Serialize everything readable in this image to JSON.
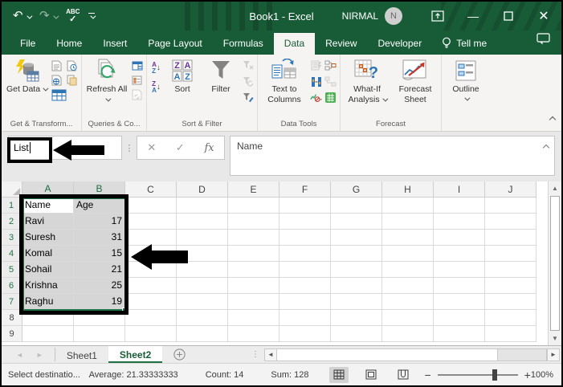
{
  "window": {
    "title": "Book1  -  Excel",
    "user": "NIRMAL",
    "avatar_initial": "N"
  },
  "menu": {
    "tabs": [
      "File",
      "Home",
      "Insert",
      "Page Layout",
      "Formulas",
      "Data",
      "Review",
      "Developer"
    ],
    "active_tab": "Data",
    "tell_me": "Tell me"
  },
  "ribbon": {
    "buttons": {
      "get_data": "Get Data",
      "refresh_all": "Refresh All",
      "sort": "Sort",
      "filter": "Filter",
      "text_to_columns": "Text to Columns",
      "what_if_analysis": "What-If Analysis",
      "forecast_sheet": "Forecast Sheet",
      "outline": "Outline"
    },
    "group_labels": {
      "get_transform": "Get & Transform...",
      "queries": "Queries & Co...",
      "sort_filter": "Sort & Filter",
      "data_tools": "Data Tools",
      "forecast": "Forecast"
    }
  },
  "formula": {
    "name_box_value": "List",
    "formula_bar_value": "Name"
  },
  "grid": {
    "columns": [
      "A",
      "B",
      "C",
      "D",
      "E",
      "F",
      "G",
      "H",
      "I",
      "J"
    ],
    "row_numbers": [
      1,
      2,
      3,
      4,
      5,
      6,
      7,
      8,
      9
    ],
    "cells": [
      [
        "Name",
        "Age"
      ],
      [
        "Ravi",
        "17"
      ],
      [
        "Suresh",
        "31"
      ],
      [
        "Komal",
        "15"
      ],
      [
        "Sohail",
        "21"
      ],
      [
        "Krishna",
        "25"
      ],
      [
        "Raghu",
        "19"
      ]
    ],
    "selected_columns": [
      "A",
      "B"
    ],
    "selected_rows": [
      1,
      2,
      3,
      4,
      5,
      6,
      7
    ],
    "active_cell": "A1"
  },
  "sheetbar": {
    "tabs": [
      "Sheet1",
      "Sheet2"
    ],
    "active_tab": "Sheet2"
  },
  "statusbar": {
    "left_text": "Select destinatio...",
    "average": "Average: 21.33333333",
    "count": "Count: 14",
    "sum": "Sum: 128",
    "zoom_level": "100%"
  },
  "icons": {
    "undo": "↶",
    "redo": "↷",
    "spell_abc": "ABC",
    "spell_check": "✓",
    "cancel": "✕",
    "enter": "✓",
    "fx": "fx",
    "separator_dots": "⋮",
    "scroll_up": "▲",
    "scroll_down": "▼",
    "scroll_left": "◄",
    "scroll_right": "►",
    "nav_left": "◄",
    "nav_right": "►",
    "zoom_minus": "−",
    "zoom_plus": "+",
    "minimize": "—",
    "sort_a": "A",
    "sort_z": "Z",
    "sort_arrow": "↓"
  }
}
